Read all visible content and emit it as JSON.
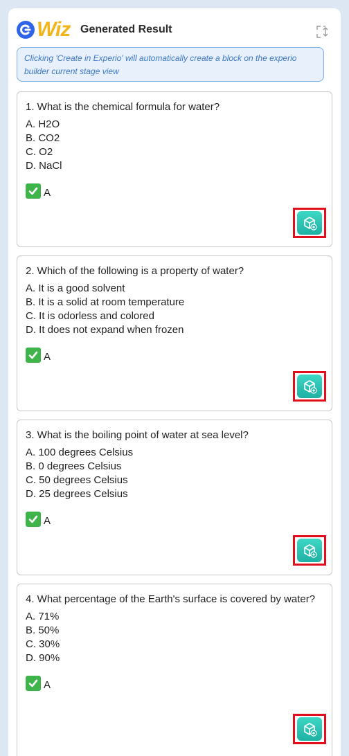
{
  "header": {
    "logo_text": "Wiz",
    "title": "Generated Result",
    "expand_icon": "expand-icon"
  },
  "notice": {
    "text": "Clicking 'Create in Experio' will automatically create a block on the experio builder current stage view"
  },
  "questions": [
    {
      "question": "1. What is the chemical formula for water?",
      "options": [
        "A. H2O",
        "B. CO2",
        "C. O2",
        "D. NaCl"
      ],
      "answer": "A"
    },
    {
      "question": "2. Which of the following is a property of water?",
      "options": [
        "A. It is a good solvent",
        "B. It is a solid at room temperature",
        "C. It is odorless and colored",
        "D. It does not expand when frozen"
      ],
      "answer": "A"
    },
    {
      "question": "3. What is the boiling point of water at sea level?",
      "options": [
        "A. 100 degrees Celsius",
        "B. 0 degrees Celsius",
        "C. 50 degrees Celsius",
        "D. 25 degrees Celsius"
      ],
      "answer": "A"
    },
    {
      "question": "4. What percentage of the Earth's surface is covered by water?",
      "options": [
        "A. 71%",
        "B. 50%",
        "C. 30%",
        "D. 90%"
      ],
      "answer": "A"
    }
  ],
  "colors": {
    "accent_teal": "#26c2b2",
    "highlight_red": "#e10f1b",
    "check_green": "#3fb44b",
    "logo_blue": "#2f64e8",
    "logo_yellow": "#f2b51b"
  }
}
